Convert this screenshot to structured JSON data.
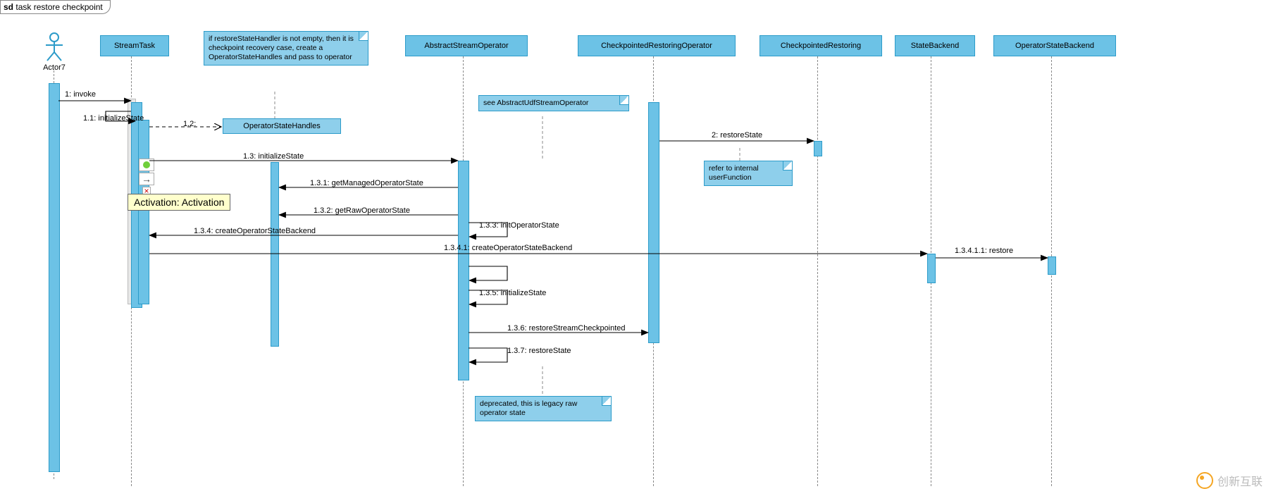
{
  "frame": {
    "prefix": "sd",
    "title": "task restore checkpoint"
  },
  "actor": {
    "name": "Actor7"
  },
  "participants": {
    "streamTask": "StreamTask",
    "abstractStreamOperator": "AbstractStreamOperator",
    "checkpointedRestoringOperator": "CheckpointedRestoringOperator",
    "checkpointedRestoring": "CheckpointedRestoring",
    "stateBackend": "StateBackend",
    "operatorStateBackend": "OperatorStateBackend"
  },
  "objects": {
    "operatorStateHandles": "OperatorStateHandles"
  },
  "notes": {
    "recovery": "if restoreStateHandler is not empty, then it is checkpoint recovery case, create a OperatorStateHandles and pass to operator",
    "seeAbstract": "see  AbstractUdfStreamOperator",
    "referInternal": "refer to internal userFunction",
    "deprecated": "deprecated, this is legacy raw  operator state"
  },
  "tooltip": "Activation: Activation",
  "messages": {
    "m1": "1: invoke",
    "m1_1": "1.1: initializeState",
    "m1_2": "1.2:",
    "m1_3": "1.3: initializeState",
    "m1_3_1": "1.3.1: getManagedOperatorState",
    "m1_3_2": "1.3.2: getRawOperatorState",
    "m1_3_3": "1.3.3: initOperatorState",
    "m1_3_4": "1.3.4: createOperatorStateBackend",
    "m1_3_4_1": "1.3.4.1: createOperatorStateBackend",
    "m1_3_4_1_1": "1.3.4.1.1: restore",
    "m1_3_5": "1.3.5: initializeState",
    "m1_3_6": "1.3.6: restoreStreamCheckpointed",
    "m1_3_7": "1.3.7: restoreState",
    "m2": "2: restoreState"
  },
  "watermark": "创新互联"
}
